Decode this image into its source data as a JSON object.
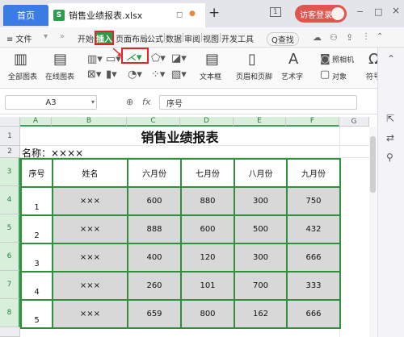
{
  "titlebar": {
    "home_tab": "首页",
    "file_tab": "销售业绩报表.xlsx",
    "file_icon": "S",
    "new_tab": "+",
    "page_indicator": "1",
    "visitor_login": "访客登录",
    "window_controls": [
      "−",
      "□",
      "×"
    ]
  },
  "menubar": {
    "file_menu": "≡ 文件",
    "items": [
      "开始",
      "插入",
      "页面布局",
      "公式",
      "数据",
      "审阅",
      "视图",
      "开发工具"
    ],
    "search": "Q查找"
  },
  "toolbar": {
    "groups": [
      {
        "label": "全部图表"
      },
      {
        "label": "在线图表"
      },
      {
        "label": "文本框"
      },
      {
        "label": "页眉和页脚"
      },
      {
        "label": "艺术字"
      },
      {
        "label": "照相机"
      },
      {
        "label": "对象"
      },
      {
        "label": "符号"
      }
    ]
  },
  "formula_bar": {
    "cell_ref": "A3",
    "fx": "fx",
    "value": "序号"
  },
  "sheet": {
    "columns": [
      "A",
      "B",
      "C",
      "D",
      "E",
      "F",
      "G"
    ],
    "rows": [
      "1",
      "2",
      "3",
      "4",
      "5",
      "6",
      "7",
      "8"
    ],
    "title": "销售业绩报表",
    "name_label": "名称：××××",
    "headers": [
      "序号",
      "姓名",
      "六月份",
      "七月份",
      "八月份",
      "九月份"
    ],
    "data": [
      [
        "1",
        "×××",
        "600",
        "880",
        "300",
        "750"
      ],
      [
        "2",
        "×××",
        "888",
        "600",
        "500",
        "432"
      ],
      [
        "3",
        "×××",
        "400",
        "120",
        "300",
        "666"
      ],
      [
        "4",
        "×××",
        "260",
        "101",
        "700",
        "333"
      ],
      [
        "5",
        "×××",
        "659",
        "800",
        "162",
        "666"
      ]
    ]
  },
  "colors": {
    "accent_blue": "#3b7ce4",
    "insert_green": "#2f9a45",
    "highlight_red": "#e02525",
    "table_border": "#2f8f3a",
    "cell_gray": "#d8d8d8"
  }
}
